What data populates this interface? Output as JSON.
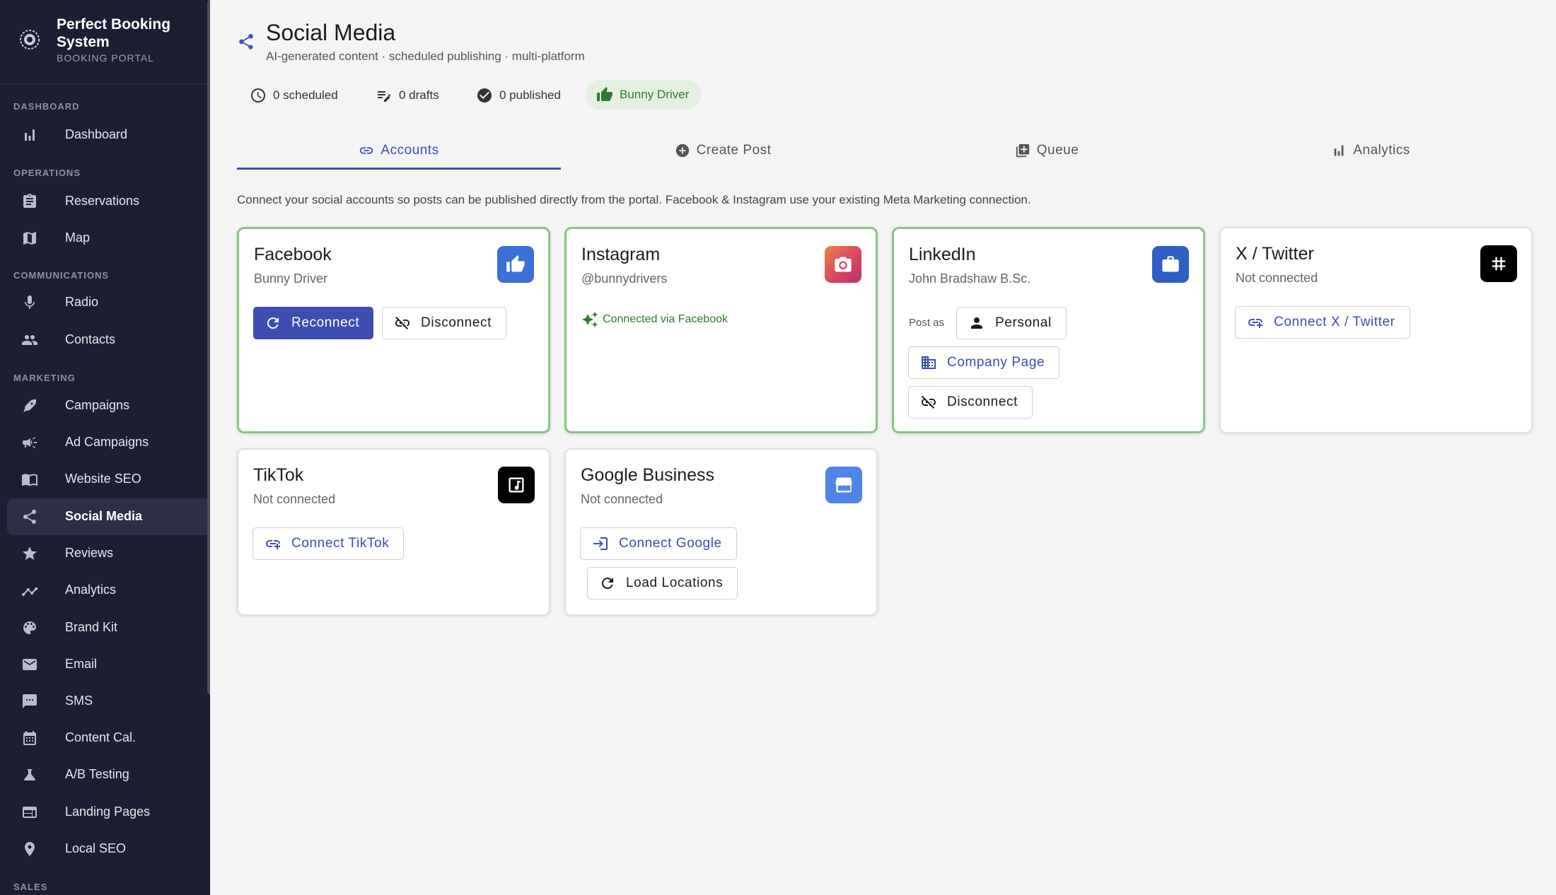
{
  "sidebar": {
    "brand_title": "Perfect Booking System",
    "brand_sub": "BOOKING PORTAL",
    "sections": {
      "dashboard": "DASHBOARD",
      "operations": "OPERATIONS",
      "communications": "COMMUNICATIONS",
      "marketing": "MARKETING",
      "sales": "SALES"
    },
    "items": {
      "dashboard": "Dashboard",
      "reservations": "Reservations",
      "map": "Map",
      "radio": "Radio",
      "contacts": "Contacts",
      "campaigns": "Campaigns",
      "ad_campaigns": "Ad Campaigns",
      "website_seo": "Website SEO",
      "social_media": "Social Media",
      "reviews": "Reviews",
      "analytics": "Analytics",
      "brand_kit": "Brand Kit",
      "email": "Email",
      "sms": "SMS",
      "content_cal": "Content Cal.",
      "ab_testing": "A/B Testing",
      "landing_pages": "Landing Pages",
      "local_seo": "Local SEO"
    },
    "active_item": "Social Media"
  },
  "header": {
    "title": "Social Media",
    "subtitle": "AI-generated content · scheduled publishing · multi-platform"
  },
  "stats": {
    "scheduled": "0 scheduled",
    "drafts": "0 drafts",
    "published": "0 published",
    "page_chip": "Bunny Driver"
  },
  "tabs": {
    "accounts": "Accounts",
    "create_post": "Create Post",
    "queue": "Queue",
    "analytics": "Analytics",
    "active": "Accounts"
  },
  "intro": "Connect your social accounts so posts can be published directly from the portal. Facebook & Instagram use your existing Meta Marketing connection.",
  "accounts": {
    "facebook": {
      "name": "Facebook",
      "account": "Bunny Driver",
      "reconnect": "Reconnect",
      "disconnect": "Disconnect",
      "color": "#3b6fd8"
    },
    "instagram": {
      "name": "Instagram",
      "account": "@bunnydrivers",
      "status": "Connected via Facebook",
      "color": "#d9455f"
    },
    "linkedin": {
      "name": "LinkedIn",
      "account": "John Bradshaw B.Sc.",
      "post_as": "Post as",
      "personal": "Personal",
      "company_page": "Company Page",
      "disconnect": "Disconnect",
      "color": "#2f5fc2"
    },
    "twitter": {
      "name": "X / Twitter",
      "account": "Not connected",
      "connect": "Connect X / Twitter",
      "color": "#000000"
    },
    "tiktok": {
      "name": "TikTok",
      "account": "Not connected",
      "connect": "Connect TikTok",
      "color": "#000000"
    },
    "google": {
      "name": "Google Business",
      "account": "Not connected",
      "connect": "Connect Google",
      "load": "Load Locations",
      "color": "#4f86e6"
    }
  },
  "colors": {
    "sidebar_bg": "#1c1f33",
    "accent": "#3a4eb5",
    "connected_border": "#86c77f",
    "success_text": "#2f7a2f"
  }
}
